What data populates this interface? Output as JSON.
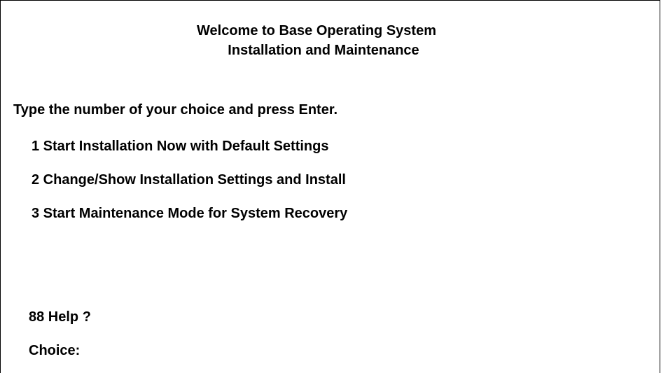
{
  "header": {
    "title_line1": "Welcome to Base Operating System",
    "title_line2": "Installation and Maintenance"
  },
  "prompt": "Type the number of your choice and press Enter.",
  "options": [
    {
      "label": "1 Start Installation Now with Default Settings"
    },
    {
      "label": "2 Change/Show Installation Settings and Install"
    },
    {
      "label": "3 Start Maintenance Mode for System Recovery"
    }
  ],
  "help": {
    "label": "88 Help ?"
  },
  "choice": {
    "label": "Choice:",
    "value": ""
  }
}
